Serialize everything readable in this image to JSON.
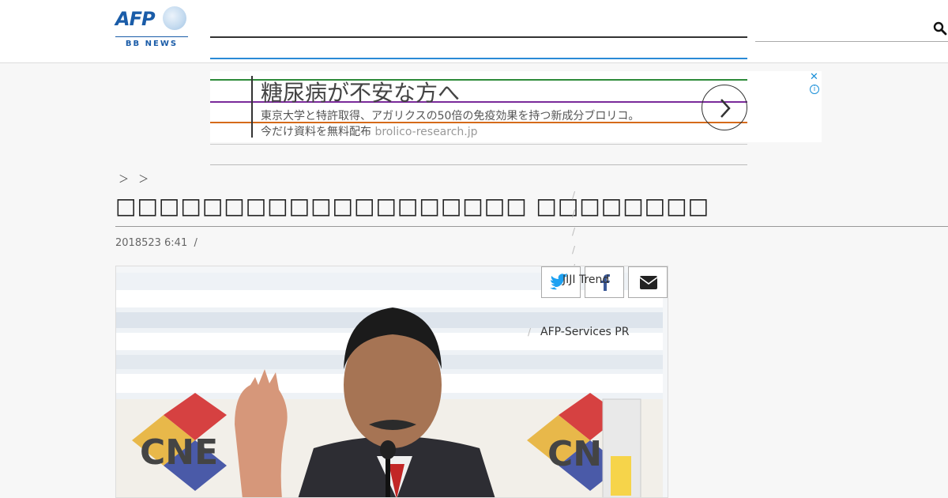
{
  "header": {
    "logo_text": "AFP",
    "logo_sub": "BB NEWS",
    "nav_line_colors": [
      "#333333",
      "#2a8ad6"
    ],
    "search_icon": "search-icon"
  },
  "ad": {
    "title": "糖尿病が不安な方へ",
    "description": "東京大学と特許取得、アガリクスの50倍の免疫効果を持つ新成分ブロリコ。",
    "cta": "今だけ資料を無料配布",
    "domain": "brolico-research.jp",
    "close_label": "✕",
    "info_label": "i",
    "arrow_icon": "chevron-right-icon",
    "line_colors": [
      "#2e8b3a",
      "#7a2a9a",
      "#d56a1a"
    ]
  },
  "article": {
    "breadcrumb": "＞ ＞",
    "title": "□□□□□□□□□□□□□□□□□□□ □□□□□□□□",
    "date": "2018523 6:41",
    "date_sep": "/",
    "slashes": "/\n/\n/\n/\n/\n/\n/",
    "jiji": "JIJI Trend",
    "services_sep": "/",
    "services": "AFP-Services PR",
    "share": {
      "twitter_icon": "twitter-icon",
      "facebook_icon": "facebook-icon",
      "email_icon": "email-icon"
    }
  }
}
